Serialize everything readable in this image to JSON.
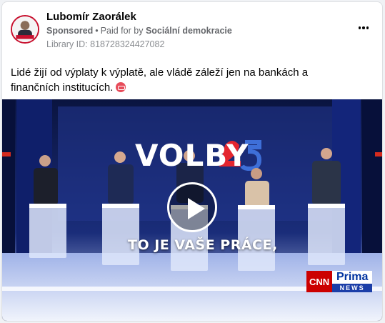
{
  "post": {
    "author": "Lubomír Zaorálek",
    "sponsored_label": "Sponsored",
    "separator": "•",
    "paid_for_prefix": "Paid for by",
    "paid_for_name": "Sociální demokracie",
    "library_id": "Library ID: 818728324427082",
    "text": "Lidé žijí od výplaty k výplatě, ale vládě záleží jen na bankách a finančních institucích.",
    "emoji_icon": "no-entry-emoji-icon",
    "more_icon": "more-options-icon"
  },
  "video": {
    "studio_title": "VOLBY 25",
    "studio_title_main": "VOLBY",
    "subtitle": "TO JE VAŠE PRÁCE,",
    "logo_cnn": "CNN",
    "logo_prima": "Prima",
    "logo_news": "NEWS",
    "play_icon": "play-icon"
  },
  "colors": {
    "author_text": "#050505",
    "meta_text": "#65676b",
    "studio_background": "#0d1c52",
    "accent_red": "#cc0000",
    "prima_blue": "#1b3ea8"
  }
}
